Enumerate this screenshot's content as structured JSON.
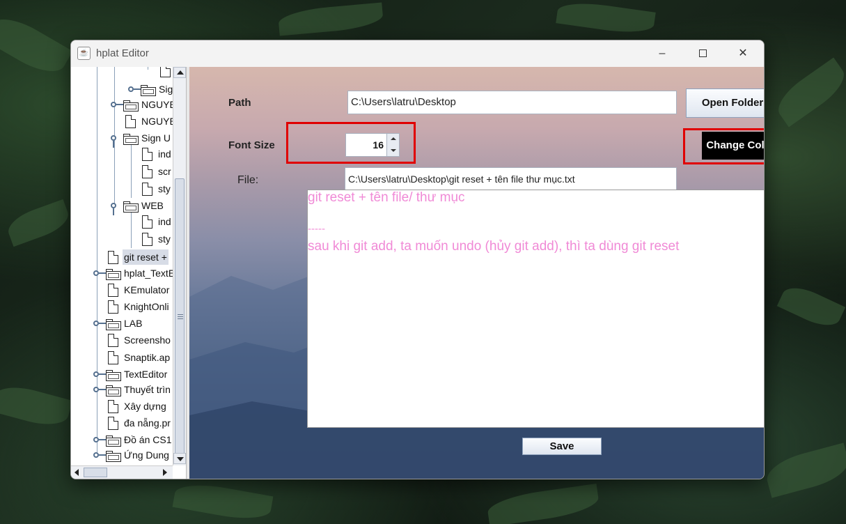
{
  "window": {
    "title": "hplat Editor",
    "app_icon": "java-coffee-icon",
    "controls": {
      "minimize": "–",
      "maximize": "□",
      "close": "✕"
    }
  },
  "tree": {
    "items": [
      {
        "label": ""
      },
      {
        "label": "Sig"
      },
      {
        "label": "NGUYE"
      },
      {
        "label": "NGUYE"
      },
      {
        "label": "Sign U"
      },
      {
        "label": "ind"
      },
      {
        "label": "scr"
      },
      {
        "label": "sty"
      },
      {
        "label": "WEB"
      },
      {
        "label": "ind"
      },
      {
        "label": "sty"
      },
      {
        "label": "git reset +"
      },
      {
        "label": "hplat_TextE"
      },
      {
        "label": "KEmulator"
      },
      {
        "label": "KnightOnli"
      },
      {
        "label": "LAB"
      },
      {
        "label": "Screensho"
      },
      {
        "label": "Snaptik.ap"
      },
      {
        "label": "TextEditor"
      },
      {
        "label": "Thuyết trìn"
      },
      {
        "label": "Xây dựng"
      },
      {
        "label": "đa nẵng.pr"
      },
      {
        "label": "Đồ án CS1"
      },
      {
        "label": "Ứng Dung"
      }
    ]
  },
  "form": {
    "path_label": "Path",
    "path_value": "C:\\Users\\latru\\Desktop",
    "open_folder_label": "Open Folder",
    "font_size_label": "Font Size",
    "font_size_value": "16",
    "change_color_label": "Change Color",
    "file_label": "File:",
    "file_value": "C:\\Users\\latru\\Desktop\\git reset + tên file thư mục.txt",
    "save_label": "Save"
  },
  "editor": {
    "text_color": "#f08ad6",
    "lines": [
      "git reset + tên file/ thư mục",
      "",
      "-----",
      "sau khi git add, ta muốn undo (hủy git add), thì ta dùng git reset"
    ]
  },
  "colors": {
    "highlight": "#e00000",
    "change_color_button_bg": "#000000"
  }
}
